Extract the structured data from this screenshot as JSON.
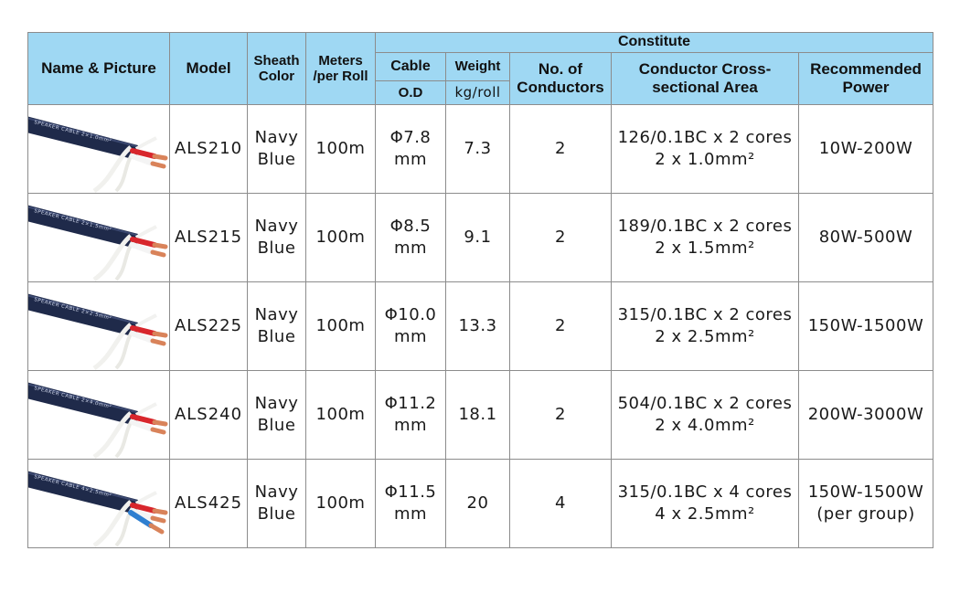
{
  "header": {
    "name_picture": "Name & Picture",
    "model": "Model",
    "sheath_color_1": "Sheath",
    "sheath_color_2": "Color",
    "meters_1": "Meters",
    "meters_2": "/per Roll",
    "constitute": "Constitute",
    "cable": "Cable",
    "od": "O.D",
    "weight": "Weight",
    "weight_unit": "kg/roll",
    "conductors_1": "No. of",
    "conductors_2": "Conductors",
    "area_1": "Conductor Cross-",
    "area_2": "sectional Area",
    "power_1": "Recommended",
    "power_2": "Power"
  },
  "rows": [
    {
      "label": "SPEAKER CABLE 2×1.0mm²",
      "model": "ALS210",
      "color_1": "Navy",
      "color_2": "Blue",
      "meters": "100m",
      "od_1": "Φ7.8",
      "od_2": "mm",
      "weight": "7.3",
      "conductors": "2",
      "area_1": "126/0.1BC x 2 cores",
      "area_2": "2 x 1.0mm²",
      "power_1": "10W-200W",
      "power_2": ""
    },
    {
      "label": "SPEAKER CABLE 2×1.5mm²",
      "model": "ALS215",
      "color_1": "Navy",
      "color_2": "Blue",
      "meters": "100m",
      "od_1": "Φ8.5",
      "od_2": "mm",
      "weight": "9.1",
      "conductors": "2",
      "area_1": "189/0.1BC x 2 cores",
      "area_2": "2 x 1.5mm²",
      "power_1": "80W-500W",
      "power_2": ""
    },
    {
      "label": "SPEAKER CABLE 2×2.5mm²",
      "model": "ALS225",
      "color_1": "Navy",
      "color_2": "Blue",
      "meters": "100m",
      "od_1": "Φ10.0",
      "od_2": "mm",
      "weight": "13.3",
      "conductors": "2",
      "area_1": "315/0.1BC x 2 cores",
      "area_2": "2 x 2.5mm²",
      "power_1": "150W-1500W",
      "power_2": ""
    },
    {
      "label": "SPEAKER CABLE 2×4.0mm²",
      "model": "ALS240",
      "color_1": "Navy",
      "color_2": "Blue",
      "meters": "100m",
      "od_1": "Φ11.2",
      "od_2": "mm",
      "weight": "18.1",
      "conductors": "2",
      "area_1": "504/0.1BC x 2 cores",
      "area_2": "2 x 4.0mm²",
      "power_1": "200W-3000W",
      "power_2": ""
    },
    {
      "label": "SPEAKER CABLE 4×2.5mm²",
      "model": "ALS425",
      "color_1": "Navy",
      "color_2": "Blue",
      "meters": "100m",
      "od_1": "Φ11.5",
      "od_2": "mm",
      "weight": "20",
      "conductors": "4",
      "area_1": "315/0.1BC x 4 cores",
      "area_2": "4 x 2.5mm²",
      "power_1": "150W-1500W",
      "power_2": "(per group)"
    }
  ],
  "colors": {
    "header_bg": "#9fd8f3",
    "jacket": "#1f2a4a",
    "copper": "#d9835a",
    "red_wire": "#d8262c"
  }
}
